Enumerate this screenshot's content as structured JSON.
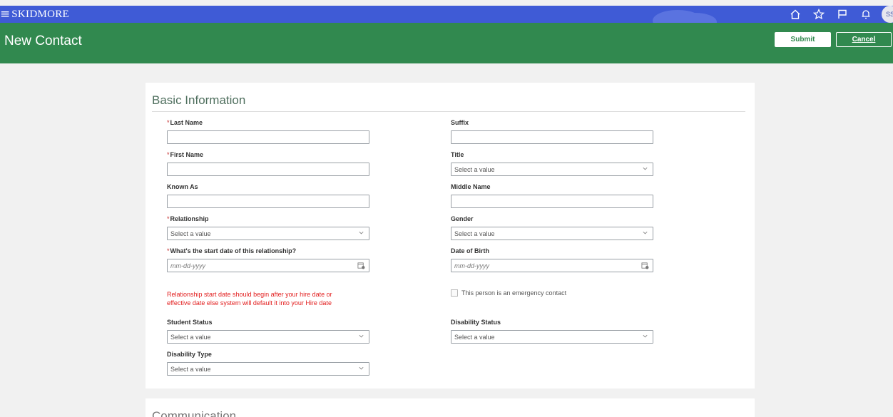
{
  "app": {
    "brand": "SKIDMORE",
    "avatar_initials": "SS",
    "icons": [
      "menu-icon",
      "home-icon",
      "star-icon",
      "flag-icon",
      "bell-icon"
    ]
  },
  "header": {
    "title": "New Contact",
    "submit_label": "Submit",
    "cancel_label": "Cancel"
  },
  "basic": {
    "title": "Basic Information",
    "last_name": {
      "label": "Last Name",
      "required": "*",
      "value": ""
    },
    "suffix": {
      "label": "Suffix",
      "value": ""
    },
    "first_name": {
      "label": "First Name",
      "required": "*",
      "value": ""
    },
    "title_field": {
      "label": "Title",
      "value": "Select a value"
    },
    "known_as": {
      "label": "Known As",
      "value": ""
    },
    "middle_name": {
      "label": "Middle Name",
      "value": ""
    },
    "relationship": {
      "label": "Relationship",
      "required": "*",
      "value": "Select a value"
    },
    "gender": {
      "label": "Gender",
      "value": "Select a value"
    },
    "start_date": {
      "label": "What's the start date of this relationship?",
      "required": "*",
      "placeholder": "mm-dd-yyyy"
    },
    "date_of_birth": {
      "label": "Date of Birth",
      "placeholder": "mm-dd-yyyy"
    },
    "warning_line1": "Relationship start date should begin after your hire date or",
    "warning_line2": "effective date else system will default it into your Hire date",
    "emergency_label": "This person is an emergency contact",
    "student_status": {
      "label": "Student Status",
      "value": "Select a value"
    },
    "disability_status": {
      "label": "Disability Status",
      "value": "Select a value"
    },
    "disability_type": {
      "label": "Disability Type",
      "value": "Select a value"
    }
  },
  "communication": {
    "title": "Communication"
  },
  "colors": {
    "nav": "#3f5bd6",
    "header": "#31894f",
    "error": "#e21c1c"
  }
}
